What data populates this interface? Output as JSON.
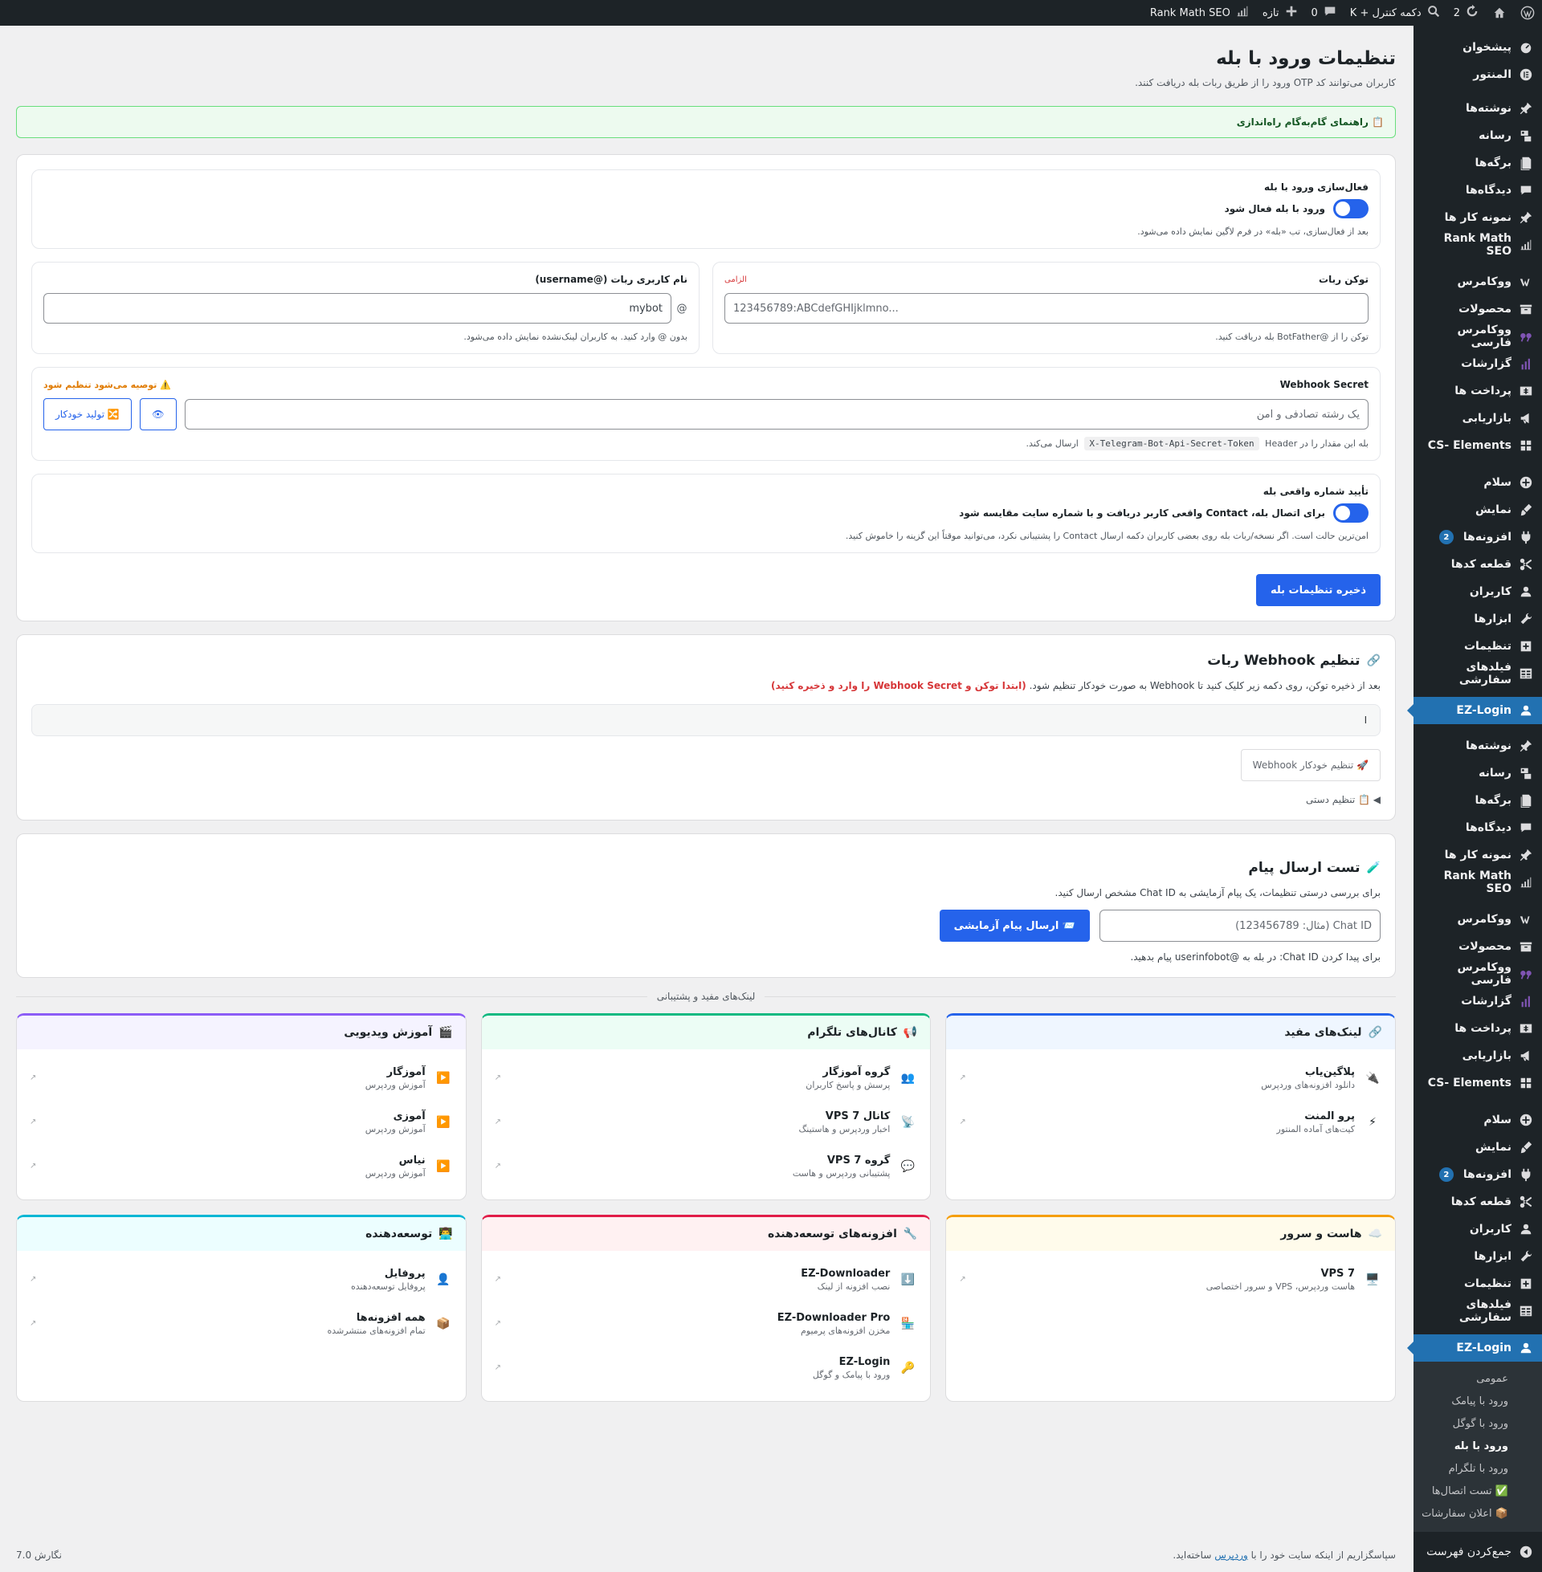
{
  "admin_bar": {
    "updates_count": "2",
    "ctrl_k": "دکمه کنترل + K",
    "comments_count": "0",
    "new_label": "تازه",
    "rankmath": "Rank Math SEO"
  },
  "sidebar": {
    "group1": [
      {
        "label": "پیشخوان",
        "icon": "dashboard-icon"
      },
      {
        "label": "المنتور",
        "icon": "elementor-icon"
      }
    ],
    "group2": [
      {
        "label": "نوشته‌ها",
        "icon": "pin-icon"
      },
      {
        "label": "رسانه",
        "icon": "media-icon"
      },
      {
        "label": "برگه‌ها",
        "icon": "page-icon"
      },
      {
        "label": "دیدگاه‌ها",
        "icon": "comment-icon"
      },
      {
        "label": "نمونه کار ها",
        "icon": "pin-icon"
      },
      {
        "label": "Rank Math SEO",
        "icon": "chart-icon"
      }
    ],
    "group3": [
      {
        "label": "ووکامرس",
        "icon": "woo-icon"
      },
      {
        "label": "محصولات",
        "icon": "archive-icon"
      },
      {
        "label": "ووکامرس فارسی",
        "icon": "persian-woo-icon"
      },
      {
        "label": "گزارشات",
        "icon": "bar-chart-icon"
      },
      {
        "label": "پرداخت ها",
        "icon": "dollar-icon"
      },
      {
        "label": "بازاریابی",
        "icon": "megaphone-icon"
      },
      {
        "label": "CS- Elements",
        "icon": "grid-icon"
      }
    ],
    "group4": [
      {
        "label": "سلام",
        "icon": "plus-circle-icon"
      },
      {
        "label": "نمایش",
        "icon": "brush-icon"
      },
      {
        "label": "افزونه‌ها",
        "icon": "plugin-icon",
        "badge": "2"
      },
      {
        "label": "قطعه کدها",
        "icon": "scissors-icon"
      },
      {
        "label": "کاربران",
        "icon": "user-icon"
      },
      {
        "label": "ابزارها",
        "icon": "wrench-icon"
      },
      {
        "label": "تنظیمات",
        "icon": "settings-icon"
      },
      {
        "label": "فیلدهای سفارشی",
        "icon": "table-icon"
      }
    ],
    "current": {
      "label": "EZ-Login",
      "icon": "user-icon"
    },
    "submenu": [
      "عمومی",
      "ورود با پیامک",
      "ورود با گوگل",
      "ورود با بله",
      "ورود با تلگرام",
      "✅ تست اتصال‌ها",
      "📦 اعلان سفارشات"
    ],
    "submenu_active": "ورود با بله",
    "collapse": "جمع‌کردن فهرست"
  },
  "page": {
    "title": "تنظیمات ورود با بله",
    "description": "کاربران می‌توانند کد OTP ورود را از طریق ربات بله دریافت کنند.",
    "guide": "📋 راهنمای گام‌به‌گام راه‌اندازی"
  },
  "activation": {
    "title": "فعال‌سازی ورود با بله",
    "toggle_label": "ورود با بله فعال شود",
    "hint": "بعد از فعال‌سازی، تب «بله» در فرم لاگین نمایش داده می‌شود."
  },
  "token": {
    "label": "توکن ربات",
    "required": "الزامی",
    "placeholder": "123456789:ABCdefGHIjklmno...",
    "hint": "توکن را از @BotFather بله دریافت کنید."
  },
  "username": {
    "label": "نام کاربری ربات (@username)",
    "prefix": "@",
    "value": "mybot",
    "hint": "بدون @ وارد کنید. به کاربران لینک‌نشده نمایش داده می‌شود."
  },
  "webhook_secret": {
    "label": "Webhook Secret",
    "warning": "⚠️ توصیه می‌شود تنظیم شود",
    "placeholder": "یک رشته تصادفی و امن",
    "eye": "👁",
    "generate": "🔀 تولید خودکار",
    "hint_before": "بله این مقدار را در",
    "hint_code": "X-Telegram-Bot-Api-Secret-Token",
    "hint_after": "Header ارسال می‌کند."
  },
  "phone_verify": {
    "title": "تأیید شماره واقعی بله",
    "toggle_label": "برای اتصال بله، Contact واقعی کاربر دریافت و با شماره سایت مقایسه شود",
    "hint": "امن‌ترین حالت است. اگر نسخه/ربات بله روی بعضی کاربران دکمه ارسال Contact را پشتیبانی نکرد، می‌توانید موقتاً این گزینه را خاموش کنید."
  },
  "save_button": "ذخیره تنظیمات بله",
  "webhook": {
    "title": "تنظیم Webhook ربات",
    "desc": "بعد از ذخیره توکن، روی دکمه زیر کلیک کنید تا Webhook به صورت خودکار تنظیم شود.",
    "desc_red": "(ابتدا توکن و Webhook Secret را وارد و ذخیره کنید)",
    "url_value": "ا",
    "auto_button": "🚀 تنظیم خودکار Webhook",
    "manual": "◀ 📋 تنظیم دستی"
  },
  "test": {
    "title": "تست ارسال پیام",
    "desc": "برای بررسی درستی تنظیمات، یک پیام آزمایشی به Chat ID مشخص ارسال کنید.",
    "placeholder": "Chat ID (مثال: 123456789)",
    "send_button": "📨 ارسال پیام آزمایشی",
    "hint": "برای پیدا کردن Chat ID: در بله به @userinfobot پیام بدهید."
  },
  "links_divider": "لینک‌های مفید و پشتیبانی",
  "link_cards": [
    {
      "title": "لینک‌های مفید",
      "icon": "🔗",
      "color": "#2563eb",
      "bg": "#eff6ff",
      "items": [
        {
          "icon": "🔌",
          "title": "پلاگین‌یاب",
          "sub": "دانلود افزونه‌های وردپرس"
        },
        {
          "icon": "⚡",
          "title": "پرو المنت",
          "sub": "کیت‌های آماده المنتور"
        }
      ]
    },
    {
      "title": "کانال‌های تلگرام",
      "icon": "📢",
      "color": "#10b981",
      "bg": "#ecfdf5",
      "items": [
        {
          "icon": "👥",
          "title": "گروه آموزگار",
          "sub": "پرسش و پاسخ کاربران"
        },
        {
          "icon": "📡",
          "title": "کانال VPS 7",
          "sub": "اخبار وردپرس و هاستینگ"
        },
        {
          "icon": "💬",
          "title": "گروه VPS 7",
          "sub": "پشتیبانی وردپرس و هاست"
        }
      ]
    },
    {
      "title": "آموزش ویدیویی",
      "icon": "🎬",
      "color": "#8b5cf6",
      "bg": "#f5f3ff",
      "items": [
        {
          "icon": "▶️",
          "title": "آموزگار",
          "sub": "آموزش وردپرس"
        },
        {
          "icon": "▶️",
          "title": "آموزی",
          "sub": "آموزش وردپرس"
        },
        {
          "icon": "▶️",
          "title": "نیاس",
          "sub": "آموزش وردپرس"
        }
      ]
    },
    {
      "title": "هاست و سرور",
      "icon": "☁️",
      "color": "#f59e0b",
      "bg": "#fffbeb",
      "items": [
        {
          "icon": "🖥️",
          "title": "VPS 7",
          "sub": "هاست وردپرس، VPS و سرور اختصاصی"
        }
      ]
    },
    {
      "title": "افزونه‌های توسعه‌دهنده",
      "icon": "🔧",
      "color": "#e11d48",
      "bg": "#fff1f2",
      "items": [
        {
          "icon": "⬇️",
          "title": "EZ-Downloader",
          "sub": "نصب افزونه از لینک"
        },
        {
          "icon": "🏪",
          "title": "EZ-Downloader Pro",
          "sub": "مخزن افزونه‌های پرمیوم"
        },
        {
          "icon": "🔑",
          "title": "EZ-Login",
          "sub": "ورود با پیامک و گوگل"
        }
      ]
    },
    {
      "title": "توسعه‌دهنده",
      "icon": "👨‍💻",
      "color": "#06b6d4",
      "bg": "#ecfeff",
      "items": [
        {
          "icon": "👤",
          "title": "پروفایل",
          "sub": "پروفایل توسعه‌دهنده"
        },
        {
          "icon": "📦",
          "title": "همه افزونه‌ها",
          "sub": "تمام افزونه‌های منتشرشده"
        }
      ]
    }
  ],
  "footer": {
    "thanks_before": "سپاسگزاریم از اینکه سایت خود را با",
    "thanks_link": "وردپرس",
    "thanks_after": "ساخته‌اید.",
    "version": "نگارش 7.0"
  }
}
